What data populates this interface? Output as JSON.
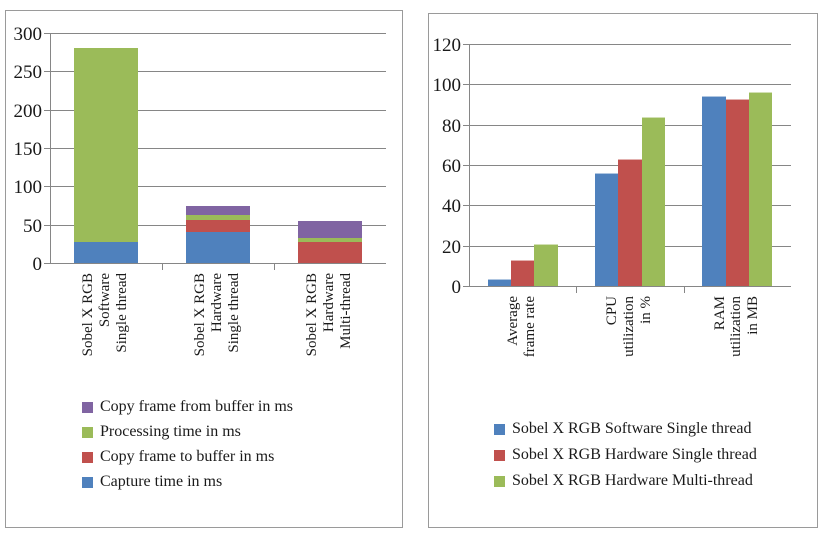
{
  "colors": {
    "series_blue": "#4F81BD",
    "series_red": "#C0504D",
    "series_green": "#9BBB59",
    "series_purple": "#8064A2",
    "gridline": "#868686",
    "panel_border": "#9A9A9A",
    "text": "#1A1A1A"
  },
  "chart_data": [
    {
      "id": "timing-breakdown",
      "type": "bar",
      "stacked": true,
      "title": "",
      "xlabel": "",
      "ylabel": "",
      "ylim": [
        0,
        300
      ],
      "yticks": [
        0,
        50,
        100,
        150,
        200,
        250,
        300
      ],
      "ytick_labels": [
        "0",
        "50",
        "100",
        "150",
        "200",
        "250",
        "300"
      ],
      "grid": true,
      "legend_position": "bottom-left",
      "categories": [
        "Sobel X RGB Software Single thread",
        "Sobel X RGB Hardware Single thread",
        "Sobel X RGB Hardware Multi-thread"
      ],
      "category_lines": [
        [
          "Sobel X RGB",
          "Software",
          "Single thread"
        ],
        [
          "Sobel X RGB",
          "Hardware",
          "Single thread"
        ],
        [
          "Sobel X RGB",
          "Hardware",
          "Multi-thread"
        ]
      ],
      "series": [
        {
          "name": "Capture time in ms",
          "color": "#4F81BD",
          "values": [
            27,
            40,
            0
          ]
        },
        {
          "name": "Copy frame to buffer in ms",
          "color": "#C0504D",
          "values": [
            0,
            16,
            27
          ]
        },
        {
          "name": "Processing time in ms",
          "color": "#9BBB59",
          "values": [
            253,
            6,
            5
          ]
        },
        {
          "name": "Copy frame from buffer in ms",
          "color": "#8064A2",
          "values": [
            0,
            12,
            23
          ]
        }
      ],
      "stack_totals": [
        280,
        74,
        55
      ],
      "legend_entries": [
        {
          "label": "Copy frame from buffer in ms",
          "color": "#8064A2"
        },
        {
          "label": "Processing time in ms",
          "color": "#9BBB59"
        },
        {
          "label": "Copy frame to buffer in ms",
          "color": "#C0504D"
        },
        {
          "label": "Capture time in ms",
          "color": "#4F81BD"
        }
      ]
    },
    {
      "id": "resource-usage",
      "type": "bar",
      "stacked": false,
      "title": "",
      "xlabel": "",
      "ylabel": "",
      "ylim": [
        0,
        120
      ],
      "yticks": [
        0,
        20,
        40,
        60,
        80,
        100,
        120
      ],
      "ytick_labels": [
        "0",
        "20",
        "40",
        "60",
        "80",
        "100",
        "120"
      ],
      "grid": true,
      "legend_position": "bottom-left",
      "categories": [
        "Average frame rate",
        "CPU utilization in %",
        "RAM utilization in MB"
      ],
      "category_lines": [
        [
          "Average",
          "frame rate"
        ],
        [
          "CPU",
          "utilization",
          "in %"
        ],
        [
          "RAM",
          "utilization",
          "in MB"
        ]
      ],
      "series": [
        {
          "name": "Sobel X RGB Software Single thread",
          "color": "#4F81BD",
          "values": [
            3.5,
            56,
            94
          ]
        },
        {
          "name": "Sobel X RGB Hardware Single thread",
          "color": "#C0504D",
          "values": [
            13,
            63,
            92.5
          ]
        },
        {
          "name": "Sobel X RGB Hardware Multi-thread",
          "color": "#9BBB59",
          "values": [
            21,
            84,
            96
          ]
        }
      ],
      "legend_entries": [
        {
          "label": "Sobel X RGB Software Single thread",
          "color": "#4F81BD"
        },
        {
          "label": "Sobel X RGB Hardware Single thread",
          "color": "#C0504D"
        },
        {
          "label": "Sobel X RGB Hardware Multi-thread",
          "color": "#9BBB59"
        }
      ]
    }
  ]
}
